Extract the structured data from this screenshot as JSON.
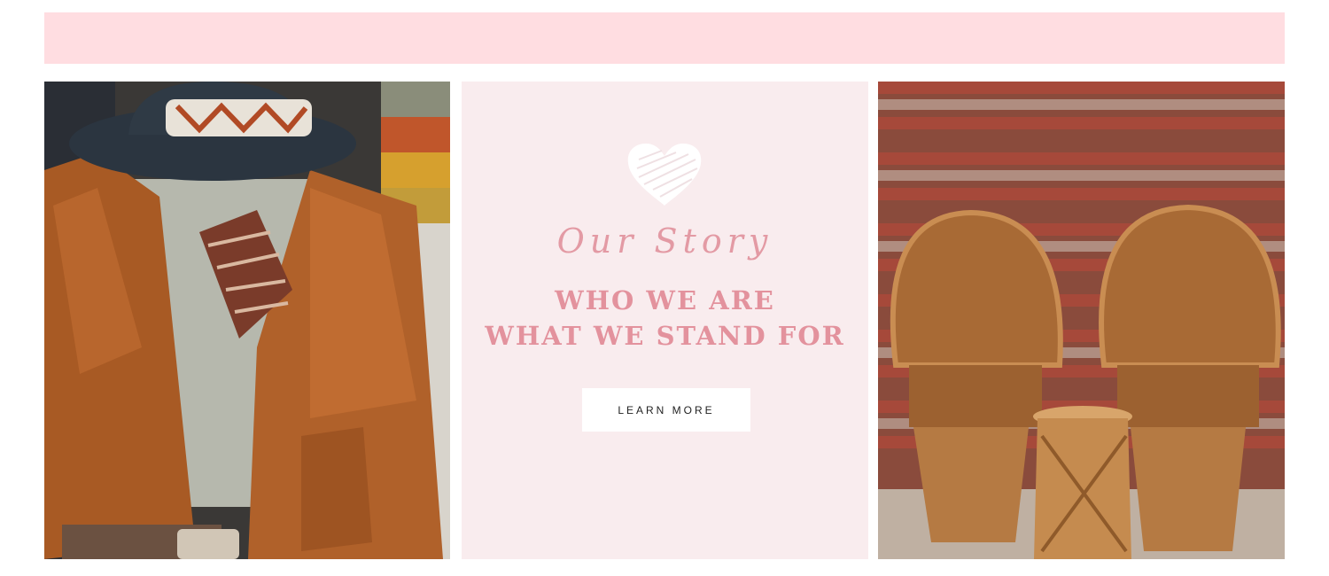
{
  "colors": {
    "banner": "#ffdde1",
    "story_panel": "#f9ecee",
    "accent_pink": "#e3929d",
    "button_bg": "#ffffff"
  },
  "left_image": {
    "icon": "clothing-photo",
    "subject": "felt hat, rust corduroy jacket, knit sweater, plaid scarf"
  },
  "story": {
    "heart_icon": "heart-icon",
    "script_title": "Our Story",
    "headline_line1": "WHO WE ARE",
    "headline_line2": "WHAT WE STAND FOR",
    "button_label": "LEARN MORE"
  },
  "right_image": {
    "icon": "furniture-photo",
    "subject": "two wicker peacock chairs and rattan side table against brick wall"
  }
}
